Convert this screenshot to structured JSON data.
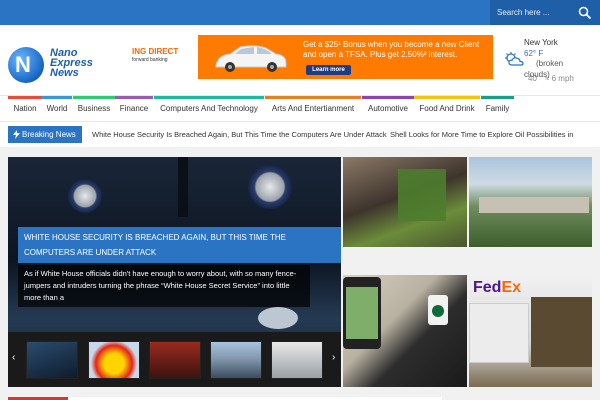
{
  "search": {
    "placeholder": "Search here ...",
    "icon": "search-icon"
  },
  "logo": {
    "letter": "N",
    "lines": [
      "Nano",
      "Express",
      "News"
    ]
  },
  "ad": {
    "bank_name": "ING DIRECT",
    "bank_sub": "forward banking",
    "text": "Get a $25¹ Bonus when you become a new Client and open a TFSA. Plus get 2.50%² interest.",
    "button": "Learn more"
  },
  "weather": {
    "city": "New York",
    "temp": "62° F",
    "condition_line1": "(broken",
    "condition_line2": "clouds)",
    "low": "40",
    "wind": "6 mph",
    "icon": "cloud-sun-icon"
  },
  "nav": {
    "items": [
      {
        "label": "Nation",
        "color": "#e74c3c"
      },
      {
        "label": "World",
        "color": "#3498db"
      },
      {
        "label": "Business",
        "color": "#2ecc71"
      },
      {
        "label": "Finance",
        "color": "#9b59b6"
      },
      {
        "label": "Computers And Technology",
        "color": "#1abc9c"
      },
      {
        "label": "Arts And Entertianment",
        "color": "#e67e22"
      },
      {
        "label": "Automotive",
        "color": "#8e44ad"
      },
      {
        "label": "Food And Drink",
        "color": "#f1c40f"
      },
      {
        "label": "Family",
        "color": "#16a085"
      }
    ]
  },
  "breaking": {
    "label": "Breaking News",
    "items": [
      "White House Security Is Breached Again, But This Time the Computers Are Under Attack",
      "Shell Looks for More Time to Explore Oil Possibilities in"
    ]
  },
  "slider": {
    "title": "White House Security Is Breached Again, But This Time the Computers Are Under Attack",
    "excerpt": "As if White House officials didn't have enough to worry about, with so many fence-jumpers and intruders turning the phrase “White House Secret Service” into little more than a",
    "prev": "‹",
    "next": "›"
  },
  "colors": {
    "accent": "#2b74c4",
    "topbar": "#2b74c4",
    "ad": "#ff7a00"
  }
}
